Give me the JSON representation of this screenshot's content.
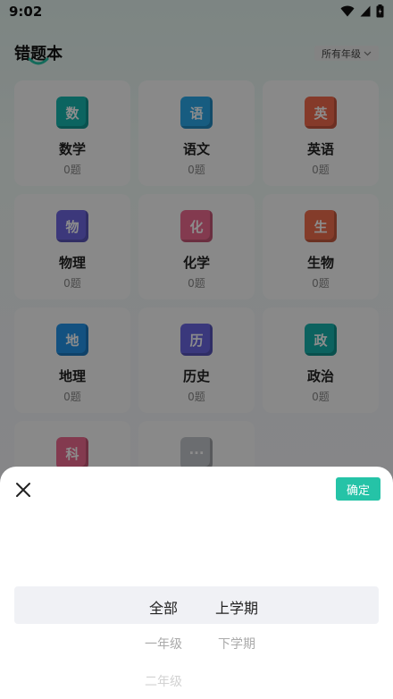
{
  "status_bar": {
    "time": "9:02"
  },
  "header": {
    "title": "错题本",
    "grade_filter": "所有年级"
  },
  "subjects": [
    {
      "icon_char": "数",
      "name": "数学",
      "count": "0题",
      "color": "#17b7b0"
    },
    {
      "icon_char": "语",
      "name": "语文",
      "count": "0题",
      "color": "#2aa8ea"
    },
    {
      "icon_char": "英",
      "name": "英语",
      "count": "0题",
      "color": "#f26b4e"
    },
    {
      "icon_char": "物",
      "name": "物理",
      "count": "0题",
      "color": "#6d67e0"
    },
    {
      "icon_char": "化",
      "name": "化学",
      "count": "0题",
      "color": "#ee6a91"
    },
    {
      "icon_char": "生",
      "name": "生物",
      "count": "0题",
      "color": "#f06e4e"
    },
    {
      "icon_char": "地",
      "name": "地理",
      "count": "0题",
      "color": "#2394ea"
    },
    {
      "icon_char": "历",
      "name": "历史",
      "count": "0题",
      "color": "#6a66e2"
    },
    {
      "icon_char": "政",
      "name": "政治",
      "count": "0题",
      "color": "#16b2ad"
    },
    {
      "icon_char": "科",
      "name": "",
      "count": "",
      "color": "#ee6a91"
    },
    {
      "icon_char": "···",
      "name": "",
      "count": "",
      "color": "#c4c7cc"
    }
  ],
  "sheet": {
    "confirm_label": "确定",
    "grade_options": [
      "全部",
      "一年级",
      "二年级"
    ],
    "term_options": [
      "上学期",
      "下学期"
    ]
  }
}
